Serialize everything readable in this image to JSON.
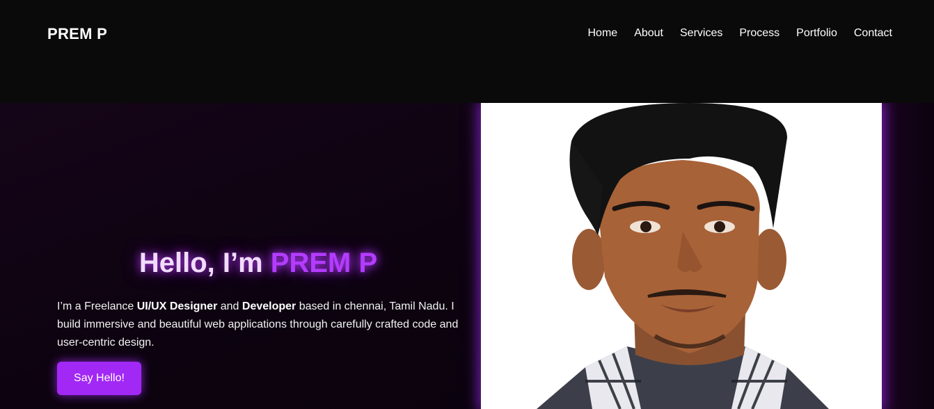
{
  "nav": {
    "brand": "PREM P",
    "links": [
      {
        "label": "Home"
      },
      {
        "label": "About"
      },
      {
        "label": "Services"
      },
      {
        "label": "Process"
      },
      {
        "label": "Portfolio"
      },
      {
        "label": "Contact"
      }
    ]
  },
  "hero": {
    "greeting": "Hello, I’m ",
    "name": "PREM P",
    "description": {
      "part1": "I’m a Freelance ",
      "role1": "UI/UX Designer",
      "part2": " and ",
      "role2": "Developer",
      "part3": " based in chennai, Tamil Nadu. I build immersive and beautiful web applications through carefully crafted code and user-centric design."
    },
    "cta_label": "Say Hello!",
    "photo": "portrait-photo"
  },
  "colors": {
    "background": "#0a0a0a",
    "accent": "#b43cff",
    "button": "#a228f5"
  }
}
